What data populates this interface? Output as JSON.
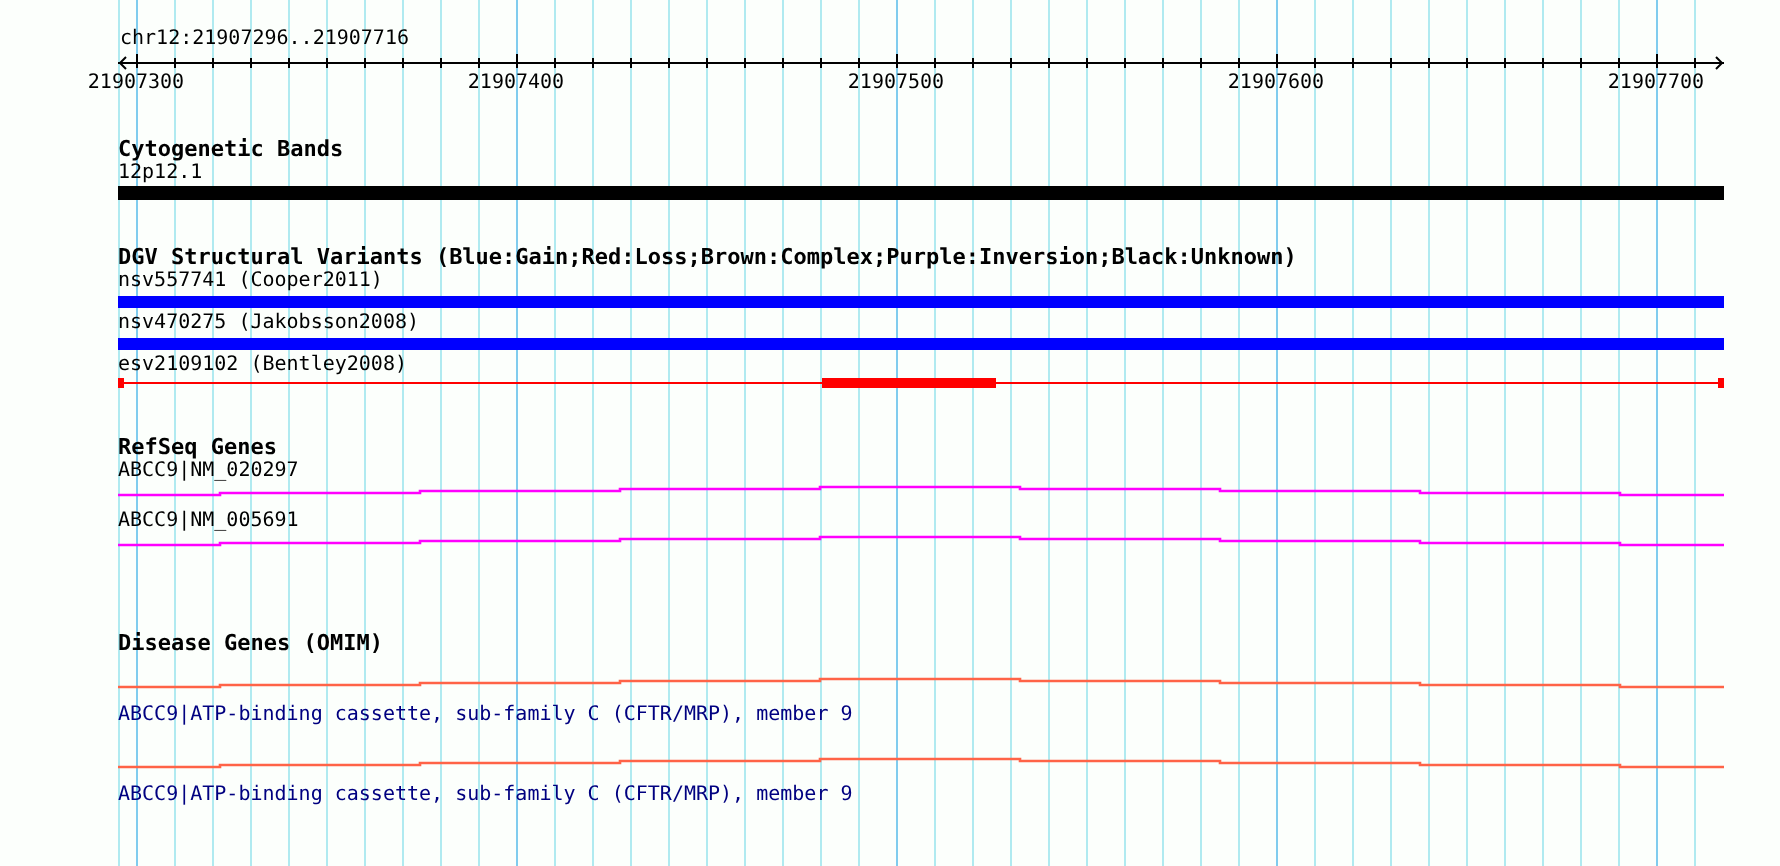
{
  "ruler": {
    "location": "chr12:21907296..21907716",
    "ticks": [
      "21907300",
      "21907400",
      "21907500",
      "21907600",
      "21907700"
    ]
  },
  "tracks": [
    {
      "title": "Cytogenetic Bands",
      "features": [
        {
          "kind": "band",
          "label": "12p12.1",
          "color": "#000000"
        }
      ]
    },
    {
      "title": "DGV Structural Variants (Blue:Gain;Red:Loss;Brown:Complex;Purple:Inversion;Black:Unknown)",
      "features": [
        {
          "kind": "bar",
          "label": "nsv557741 (Cooper2011)",
          "color": "#0000ff"
        },
        {
          "kind": "bar",
          "label": "nsv470275 (Jakobsson2008)",
          "color": "#0000ff"
        },
        {
          "kind": "span",
          "label": "esv2109102 (Bentley2008)",
          "color": "#ff0000"
        }
      ]
    },
    {
      "title": "RefSeq Genes",
      "features": [
        {
          "kind": "gene",
          "label": "ABCC9|NM_020297",
          "color": "#ff00ff"
        },
        {
          "kind": "gene",
          "label": "ABCC9|NM_005691",
          "color": "#ff00ff"
        }
      ]
    },
    {
      "title": "Disease Genes (OMIM)",
      "features": [
        {
          "kind": "disease",
          "label": "ABCC9|ATP-binding cassette, sub-family C (CFTR/MRP), member 9",
          "color": "#ff6347"
        },
        {
          "kind": "disease",
          "label": "ABCC9|ATP-binding cassette, sub-family C (CFTR/MRP), member 9",
          "color": "#ff6347"
        }
      ]
    }
  ]
}
